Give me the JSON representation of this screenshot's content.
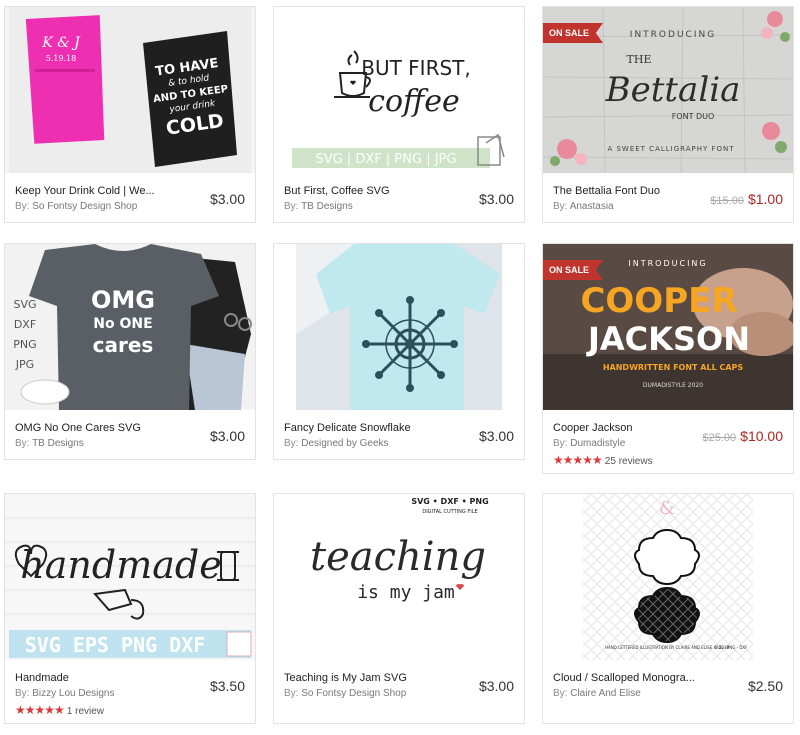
{
  "by_label": "By:",
  "products": [
    {
      "title": "Keep Your Drink Cold | We...",
      "shop": "So Fontsy Design Shop",
      "price": "$3.00",
      "image_text": [
        "K & J",
        "5.19.18",
        "TO HAVE",
        "& to hold",
        "AND TO KEEP",
        "your drink",
        "COLD"
      ]
    },
    {
      "title": "But First, Coffee SVG",
      "shop": "TB Designs",
      "price": "$3.00",
      "image_text": [
        "BUT FIRST,",
        "coffee",
        "SVG | DXF | PNG | JPG"
      ]
    },
    {
      "title": "The Bettalia Font Duo",
      "shop": "Anastasia",
      "badge": "ON SALE",
      "old_price": "$15.00",
      "price": "$1.00",
      "image_text": [
        "INTRODUCING",
        "THE",
        "Bettalia",
        "FONT DUO",
        "A SWEET CALLIGRAPHY FONT"
      ]
    },
    {
      "title": "OMG No One Cares SVG",
      "shop": "TB Designs",
      "price": "$3.00",
      "image_text": [
        "OMG",
        "No ONE",
        "cares",
        "SVG",
        "DXF",
        "PNG",
        "JPG"
      ]
    },
    {
      "title": "Fancy Delicate Snowflake",
      "shop": "Designed by Geeks",
      "price": "$3.00",
      "image_text": []
    },
    {
      "title": "Cooper Jackson",
      "shop": "Dumadistyle",
      "badge": "ON SALE",
      "old_price": "$25.00",
      "price": "$10.00",
      "stars": "★★★★★",
      "reviews": "25 reviews",
      "image_text": [
        "INTRODUCING",
        "COOPER",
        "JACKSON",
        "HANDWRITTEN FONT ALL CAPS",
        "DUMADISTYLE 2020"
      ]
    },
    {
      "title": "Handmade",
      "shop": "Bizzy Lou Designs",
      "price": "$3.50",
      "stars": "★★★★★",
      "reviews": "1 review",
      "image_text": [
        "handmade",
        "SVG EPS PNG DXF"
      ]
    },
    {
      "title": "Teaching is My Jam SVG",
      "shop": "So Fontsy Design Shop",
      "price": "$3.00",
      "image_text": [
        "SVG • DXF • PNG",
        "DIGITAL CUTTING FILE",
        "teaching",
        "is my jam"
      ]
    },
    {
      "title": "Cloud / Scalloped Monogra...",
      "shop": "Claire And Elise",
      "price": "$2.50",
      "image_text": [
        "HAND LETTERED ILLUSTRATION BY CLAIRE AND ELISE © 2018",
        "SVG - PNG - DXF"
      ]
    }
  ]
}
